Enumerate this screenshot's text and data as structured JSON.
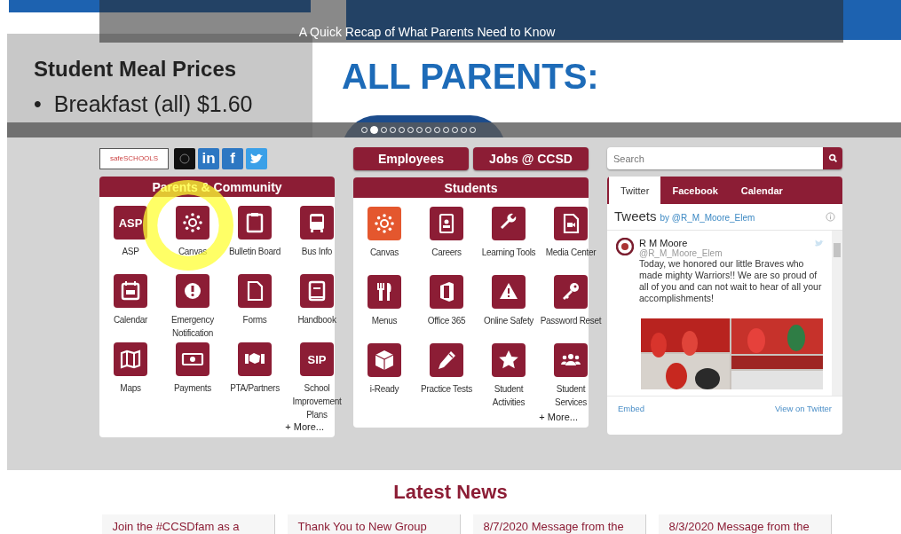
{
  "slideshow": {
    "caption": "A Quick Recap of What Parents Need to Know",
    "heading": "Student Meal Prices",
    "items": [
      {
        "bullet": "•",
        "text": "Breakfast (all) $1.60"
      }
    ],
    "headline": "ALL PARENTS:",
    "dots": [
      {
        "selected": false
      },
      {
        "selected": true
      },
      {
        "selected": false
      },
      {
        "selected": false
      },
      {
        "selected": false
      },
      {
        "selected": false
      },
      {
        "selected": false
      },
      {
        "selected": false
      },
      {
        "selected": false
      },
      {
        "selected": false
      },
      {
        "selected": false
      },
      {
        "selected": false
      },
      {
        "selected": false
      }
    ]
  },
  "social": [
    {
      "kind": "logo",
      "label": "safeSCHOOLS"
    },
    {
      "kind": "dark"
    },
    {
      "kind": "letter",
      "label": "in"
    },
    {
      "kind": "letter",
      "label": "f"
    },
    {
      "kind": "bird"
    }
  ],
  "top_buttons": [
    "Employees",
    "Jobs @ CCSD"
  ],
  "panels": [
    {
      "title": "Parents & Community",
      "more": "+ More...",
      "tiles": [
        {
          "label": "ASP",
          "badge": "ASP",
          "kind": "tile"
        },
        {
          "label": "Canvas",
          "kind": "tile"
        },
        {
          "label": "Bulletin Board",
          "kind": "tile"
        },
        {
          "label": "Bus Info",
          "kind": "tile"
        },
        {
          "label": "Calendar",
          "kind": "tile"
        },
        {
          "label": "Emergency Notification",
          "kind": "tile"
        },
        {
          "label": "Forms",
          "kind": "tile"
        },
        {
          "label": "Handbook",
          "kind": "tile"
        },
        {
          "label": "Maps",
          "kind": "tile"
        },
        {
          "label": "Payments",
          "kind": "tile"
        },
        {
          "label": "PTA/Partners",
          "kind": "tile"
        },
        {
          "label": "School Improvement Plans",
          "badge": "SIP",
          "kind": "tile"
        }
      ]
    },
    {
      "title": "Students",
      "more": "+ More...",
      "tiles": [
        {
          "label": "Canvas",
          "kind": "app"
        },
        {
          "label": "Careers",
          "kind": "tile"
        },
        {
          "label": "Learning Tools",
          "kind": "tile"
        },
        {
          "label": "Media Center",
          "kind": "tile"
        },
        {
          "label": "Menus",
          "kind": "tile"
        },
        {
          "label": "Office 365",
          "kind": "tile"
        },
        {
          "label": "Online Safety",
          "kind": "tile"
        },
        {
          "label": "Password Reset",
          "kind": "tile"
        },
        {
          "label": "i-Ready",
          "kind": "tile"
        },
        {
          "label": "Practice Tests",
          "kind": "tile"
        },
        {
          "label": "Student Activities",
          "kind": "tile"
        },
        {
          "label": "Student Services",
          "kind": "tile"
        }
      ]
    }
  ],
  "search": {
    "placeholder": "Search"
  },
  "feed": {
    "tabs": [
      {
        "label": "Twitter",
        "selected": true
      },
      {
        "label": "Facebook",
        "selected": false
      },
      {
        "label": "Calendar",
        "selected": false
      }
    ],
    "title": "Tweets",
    "by": "by @R_M_Moore_Elem",
    "tweet": {
      "name": "R M Moore",
      "handle": "@R_M_Moore_Elem",
      "text": "Today, we honored our little Braves who made mighty Warriors!!  We are so proud of all of you and can not wait to hear of all your accomplishments!"
    },
    "footer": [
      "Embed",
      "View on Twitter"
    ]
  },
  "news": {
    "title": "Latest News",
    "items": [
      "Join the #CCSDfam as a",
      "Thank You to New Group",
      "8/7/2020 Message from the",
      "8/3/2020 Message from the"
    ]
  }
}
